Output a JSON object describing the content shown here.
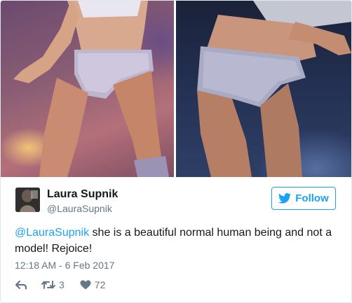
{
  "tweet": {
    "author": {
      "display_name": "Laura Supnik",
      "handle": "@LauraSupnik"
    },
    "follow_label": "Follow",
    "text": {
      "mention": "@LauraSupnik",
      "body": " she is a beautiful normal human being and not a model! Rejoice!"
    },
    "timestamp": "12:18 AM - 6 Feb 2017",
    "actions": {
      "retweet_count": "3",
      "like_count": "72"
    },
    "icons": {
      "follow": "twitter-bird-icon",
      "reply": "reply-icon",
      "retweet": "retweet-icon",
      "like": "heart-icon"
    },
    "colors": {
      "accent": "#1da1f2",
      "secondary_text": "#657786",
      "border": "#e1e8ed"
    }
  }
}
